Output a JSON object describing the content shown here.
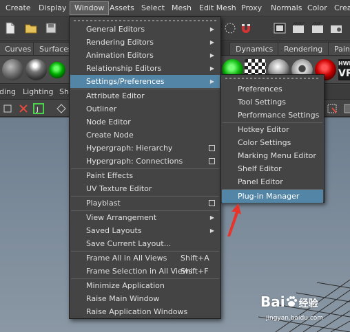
{
  "menubar": {
    "items": [
      "Create",
      "Display",
      "Window",
      "Assets",
      "Select",
      "Mesh",
      "Edit Mesh",
      "Proxy",
      "Normals",
      "Color",
      "Crea"
    ],
    "active": "Window"
  },
  "shelf": {
    "tabs": [
      "Curves",
      "Surfaces",
      "Dynamics",
      "Rendering",
      "Paint"
    ],
    "hw_badge": {
      "top": "HWI",
      "bottom": "VR"
    }
  },
  "panel_menu": [
    "ding",
    "Lighting",
    "Sho"
  ],
  "window_menu": {
    "groups": [
      [
        {
          "label": "General Editors",
          "submenu": true
        },
        {
          "label": "Rendering Editors",
          "submenu": true
        },
        {
          "label": "Animation Editors",
          "submenu": true
        },
        {
          "label": "Relationship Editors",
          "submenu": true
        },
        {
          "label": "Settings/Preferences",
          "submenu": true,
          "highlighted": true
        }
      ],
      [
        {
          "label": "Attribute Editor"
        },
        {
          "label": "Outliner"
        },
        {
          "label": "Node Editor"
        },
        {
          "label": "Create Node"
        },
        {
          "label": "Hypergraph: Hierarchy",
          "option_box": true
        },
        {
          "label": "Hypergraph: Connections",
          "option_box": true
        }
      ],
      [
        {
          "label": "Paint Effects"
        },
        {
          "label": "UV Texture Editor"
        }
      ],
      [
        {
          "label": "Playblast",
          "option_box": true
        }
      ],
      [
        {
          "label": "View Arrangement",
          "submenu": true
        },
        {
          "label": "Saved Layouts",
          "submenu": true
        },
        {
          "label": "Save Current Layout..."
        }
      ],
      [
        {
          "label": "Frame All in All Views",
          "shortcut": "Shift+A"
        },
        {
          "label": "Frame Selection in All Views",
          "shortcut": "Shift+F"
        }
      ],
      [
        {
          "label": "Minimize Application"
        },
        {
          "label": "Raise Main Window"
        },
        {
          "label": "Raise Application Windows"
        }
      ]
    ]
  },
  "settings_submenu": {
    "groups": [
      [
        "Preferences",
        "Tool Settings",
        "Performance Settings"
      ],
      [
        "Hotkey Editor",
        "Color Settings",
        "Marking Menu Editor",
        "Shelf Editor",
        "Panel Editor"
      ],
      [
        "Plug-in Manager"
      ]
    ],
    "highlighted": "Plug-in Manager"
  },
  "watermark": {
    "brand": "Bai",
    "brand_mid": "经验",
    "url": "jingyan.baidu.com"
  },
  "colors": {
    "menu_bg": "#444444",
    "highlight": "#5285a6",
    "annotation_arrow": "#e8322a"
  }
}
